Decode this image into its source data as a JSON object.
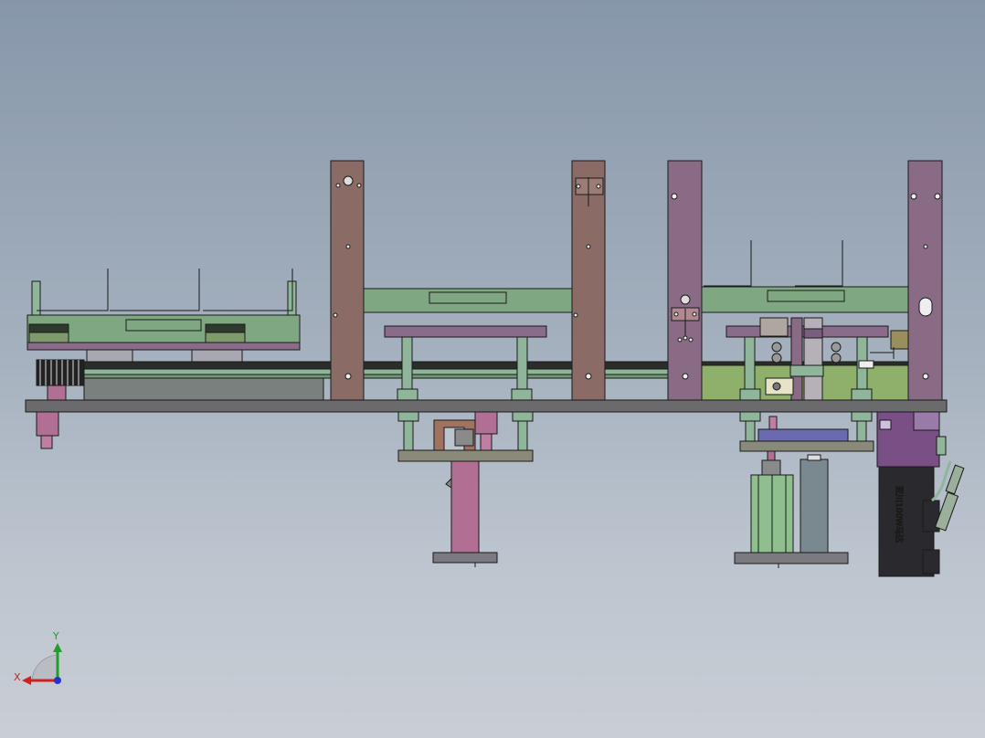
{
  "colors": {
    "background_top": "#8797aa",
    "background_bottom": "#c9ced5",
    "frame_brown": "#8a6b66",
    "base_plate": "#6b6b6e",
    "panel_green": "#7fa882",
    "rail_purple": "#8a6b8a",
    "pillar_green": "#8fb59a",
    "motor_black": "#2a2a2e",
    "motor_purple": "#7a4f86",
    "outline": "#1a1a1a"
  },
  "motor": {
    "label": "亚川100W马达"
  },
  "triad": {
    "x_label": "X",
    "y_label": "Y",
    "x_color": "#d21f1f",
    "y_color": "#1e9e2a",
    "z_color": "#2335c8"
  }
}
